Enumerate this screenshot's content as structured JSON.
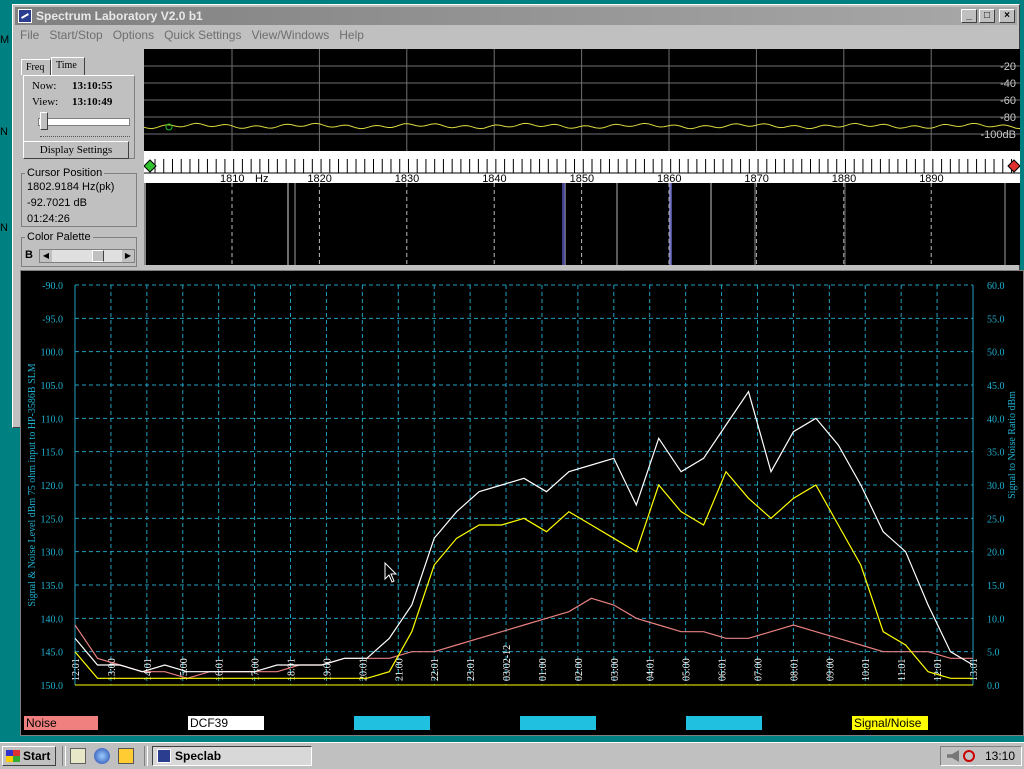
{
  "window": {
    "title": "Spectrum Laboratory V2.0 b1",
    "minimize": "_",
    "maximize": "□",
    "close": "×"
  },
  "menu": [
    "File",
    "Start/Stop",
    "Options",
    "Quick Settings",
    "View/Windows",
    "Help"
  ],
  "panel": {
    "tabs": [
      "Freq",
      "Time"
    ],
    "now_label": "Now:",
    "now_value": "13:10:55",
    "view_label": "View:",
    "view_value": "13:10:49",
    "display_settings": "Display Settings",
    "cursor_title": "Cursor Position",
    "cursor_freq": "1802.9184 Hz(pk)",
    "cursor_level": "-92.7021 dB",
    "cursor_time": "01:24:26",
    "palette_title": "Color Palette",
    "palette_letter": "B"
  },
  "spectrum": {
    "db_labels": [
      "-20",
      "-40",
      "-60",
      "-80",
      "-100dB"
    ],
    "freq_labels": [
      "1810",
      "1820",
      "1830",
      "1840",
      "1850",
      "1860",
      "1870",
      "1880",
      "1890"
    ],
    "freq_unit": "Hz"
  },
  "chart_data": {
    "type": "line",
    "left_axis_label": "Signal & Noise Level  dBm 75 ohm input to HP-3586B SLM",
    "right_axis_label": "Signal to Noise Ratio  dBm",
    "left_ylim": [
      -150,
      -90
    ],
    "right_ylim": [
      0,
      60
    ],
    "left_ticks": [
      "-90.0",
      "-95.0",
      "100.0",
      "105.0",
      "110.0",
      "115.0",
      "120.0",
      "125.0",
      "130.0",
      "135.0",
      "140.0",
      "145.0",
      "150.0"
    ],
    "right_ticks": [
      "60.0",
      "55.0",
      "50.0",
      "45.0",
      "40.0",
      "35.0",
      "30.0",
      "25.0",
      "20.0",
      "15.0",
      "10.0",
      "5.0",
      "0.0"
    ],
    "time_ticks": [
      "12:01",
      "13:00",
      "14:01",
      "15:00",
      "16:01",
      "17:00",
      "18:01",
      "19:00",
      "20:01",
      "21:00",
      "22:01",
      "23:01",
      "03/02-12",
      "01:00",
      "02:00",
      "03:00",
      "04:01",
      "05:00",
      "06:01",
      "07:00",
      "08:01",
      "09:00",
      "10:01",
      "11:01",
      "12:01",
      "13:01"
    ],
    "grid": true,
    "series": [
      {
        "name": "Noise",
        "color": "#e88080",
        "values": [
          -141,
          -146,
          -147,
          -148,
          -148,
          -149,
          -148,
          -148,
          -148,
          -148,
          -147,
          -147,
          -146,
          -146,
          -146,
          -145,
          -145,
          -144,
          -143,
          -142,
          -141,
          -140,
          -139,
          -137,
          -138,
          -140,
          -141,
          -142,
          -142,
          -143,
          -143,
          -142,
          -141,
          -142,
          -143,
          -144,
          -145,
          -145,
          -145,
          -146,
          -146
        ]
      },
      {
        "name": "DCF39",
        "color": "#ffffff",
        "values": [
          -143,
          -147,
          -147,
          -148,
          -147,
          -148,
          -148,
          -148,
          -148,
          -147,
          -147,
          -147,
          -146,
          -146,
          -143,
          -138,
          -128,
          -124,
          -121,
          -120,
          -119,
          -121,
          -118,
          -117,
          -116,
          -123,
          -113,
          -118,
          -116,
          -111,
          -106,
          -118,
          -112,
          -110,
          -114,
          -120,
          -127,
          -130,
          -138,
          -145,
          -147
        ]
      },
      {
        "name": "Signal/Noise",
        "color": "#ffff00",
        "values": [
          5,
          1,
          1,
          1,
          1,
          1,
          1,
          1,
          1,
          1,
          1,
          1,
          1,
          1,
          2,
          8,
          18,
          22,
          24,
          24,
          25,
          23,
          26,
          24,
          22,
          20,
          30,
          26,
          24,
          32,
          28,
          25,
          28,
          30,
          24,
          18,
          8,
          6,
          2,
          1,
          1
        ]
      }
    ]
  },
  "legend": {
    "noise": "Noise",
    "signal": "DCF39",
    "ratio": "Signal/Noise",
    "noise_color": "#f08080",
    "signal_color": "#ffffff",
    "ratio_color": "#ffff00",
    "blank_color": "#20c0e0"
  },
  "taskbar": {
    "start": "Start",
    "task": "Speclab",
    "clock": "13:10"
  },
  "desktop_letters": [
    "M",
    "N",
    "N"
  ]
}
